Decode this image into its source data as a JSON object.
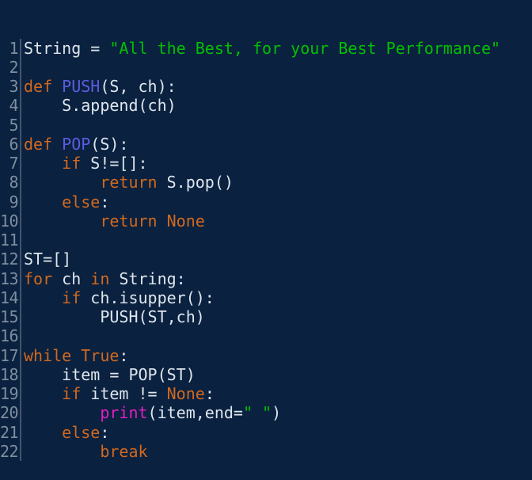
{
  "editor": {
    "language": "python",
    "background_color": "#0a2140",
    "gutter_rule_color": "#41556b",
    "line_number_color": "#7d8f9e",
    "colors": {
      "keyword": "#d2691e",
      "string": "#00c000",
      "function_def": "#5c5ce0",
      "builtin_function": "#e020c0",
      "plain": "#dfe6ec"
    },
    "line_numbers": [
      "1",
      "2",
      "3",
      "4",
      "5",
      "6",
      "7",
      "8",
      "9",
      "10",
      "11",
      "12",
      "13",
      "14",
      "15",
      "16",
      "17",
      "18",
      "19",
      "20",
      "21",
      "22"
    ],
    "lines": [
      {
        "number": "1",
        "text": "String = \"All the Best, for your Best Performance\"",
        "tokens": [
          {
            "t": "String = ",
            "c": "pl"
          },
          {
            "t": "\"All the Best, for your Best Performance\"",
            "c": "str"
          }
        ]
      },
      {
        "number": "2",
        "text": "",
        "tokens": []
      },
      {
        "number": "3",
        "text": "def PUSH(S, ch):",
        "tokens": [
          {
            "t": "def ",
            "c": "kw"
          },
          {
            "t": "PUSH",
            "c": "def"
          },
          {
            "t": "(S, ch):",
            "c": "pl"
          }
        ]
      },
      {
        "number": "4",
        "text": "    S.append(ch)",
        "tokens": [
          {
            "t": "    S.append(ch)",
            "c": "pl"
          }
        ]
      },
      {
        "number": "5",
        "text": "",
        "tokens": []
      },
      {
        "number": "6",
        "text": "def POP(S):",
        "tokens": [
          {
            "t": "def ",
            "c": "kw"
          },
          {
            "t": "POP",
            "c": "def"
          },
          {
            "t": "(S):",
            "c": "pl"
          }
        ]
      },
      {
        "number": "7",
        "text": "    if S!=[]:",
        "tokens": [
          {
            "t": "    ",
            "c": "pl"
          },
          {
            "t": "if",
            "c": "kw"
          },
          {
            "t": " S!=[]:",
            "c": "pl"
          }
        ]
      },
      {
        "number": "8",
        "text": "        return S.pop()",
        "tokens": [
          {
            "t": "        ",
            "c": "pl"
          },
          {
            "t": "return",
            "c": "kw"
          },
          {
            "t": " S.pop()",
            "c": "pl"
          }
        ]
      },
      {
        "number": "9",
        "text": "    else:",
        "tokens": [
          {
            "t": "    ",
            "c": "pl"
          },
          {
            "t": "else",
            "c": "kw"
          },
          {
            "t": ":",
            "c": "pl"
          }
        ]
      },
      {
        "number": "10",
        "text": "        return None",
        "tokens": [
          {
            "t": "        ",
            "c": "pl"
          },
          {
            "t": "return None",
            "c": "kw"
          }
        ]
      },
      {
        "number": "11",
        "text": "",
        "tokens": []
      },
      {
        "number": "12",
        "text": "ST=[]",
        "tokens": [
          {
            "t": "ST=[]",
            "c": "pl"
          }
        ]
      },
      {
        "number": "13",
        "text": "for ch in String:",
        "tokens": [
          {
            "t": "for",
            "c": "kw"
          },
          {
            "t": " ch ",
            "c": "pl"
          },
          {
            "t": "in",
            "c": "kw"
          },
          {
            "t": " String:",
            "c": "pl"
          }
        ]
      },
      {
        "number": "14",
        "text": "    if ch.isupper():",
        "tokens": [
          {
            "t": "    ",
            "c": "pl"
          },
          {
            "t": "if",
            "c": "kw"
          },
          {
            "t": " ch.isupper():",
            "c": "pl"
          }
        ]
      },
      {
        "number": "15",
        "text": "        PUSH(ST,ch)",
        "tokens": [
          {
            "t": "        PUSH(ST,ch)",
            "c": "pl"
          }
        ]
      },
      {
        "number": "16",
        "text": "",
        "tokens": []
      },
      {
        "number": "17",
        "text": "while True:",
        "tokens": [
          {
            "t": "while True",
            "c": "kw"
          },
          {
            "t": ":",
            "c": "pl"
          }
        ]
      },
      {
        "number": "18",
        "text": "    item = POP(ST)",
        "tokens": [
          {
            "t": "    item = POP(ST)",
            "c": "pl"
          }
        ]
      },
      {
        "number": "19",
        "text": "    if item != None:",
        "tokens": [
          {
            "t": "    ",
            "c": "pl"
          },
          {
            "t": "if",
            "c": "kw"
          },
          {
            "t": " item != ",
            "c": "pl"
          },
          {
            "t": "None",
            "c": "kw"
          },
          {
            "t": ":",
            "c": "pl"
          }
        ]
      },
      {
        "number": "20",
        "text": "        print(item,end=\" \")",
        "tokens": [
          {
            "t": "        ",
            "c": "pl"
          },
          {
            "t": "print",
            "c": "fn"
          },
          {
            "t": "(item,end=",
            "c": "pl"
          },
          {
            "t": "\" \"",
            "c": "str"
          },
          {
            "t": ")",
            "c": "pl"
          }
        ]
      },
      {
        "number": "21",
        "text": "    else:",
        "tokens": [
          {
            "t": "    ",
            "c": "pl"
          },
          {
            "t": "else",
            "c": "kw"
          },
          {
            "t": ":",
            "c": "pl"
          }
        ]
      },
      {
        "number": "22",
        "text": "        break",
        "tokens": [
          {
            "t": "        ",
            "c": "pl"
          },
          {
            "t": "break",
            "c": "kw"
          }
        ]
      }
    ]
  }
}
